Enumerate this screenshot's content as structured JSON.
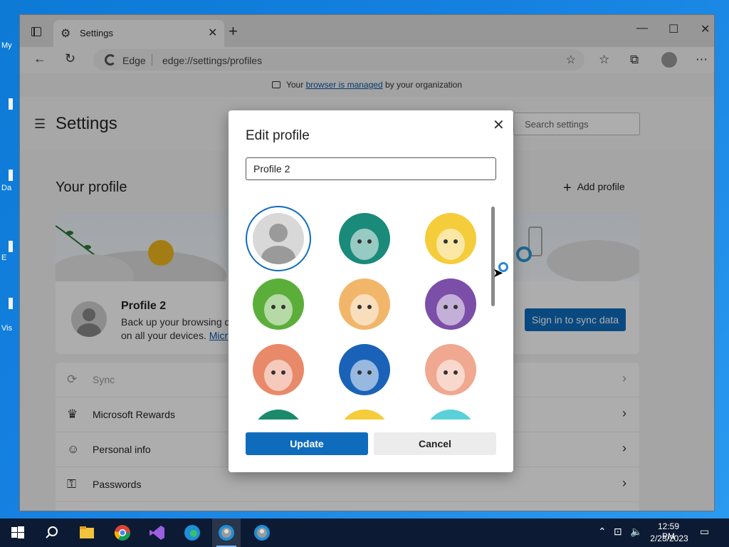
{
  "desktop": {
    "labels": [
      "My",
      "Da",
      "E",
      "Vis"
    ]
  },
  "browser": {
    "tab_title": "Settings",
    "new_tab_symbol": "+",
    "address_brand": "Edge",
    "address_url": "edge://settings/profiles",
    "managed_prefix": "Your ",
    "managed_link": "browser is managed",
    "managed_suffix": " by your organization"
  },
  "settings": {
    "title": "Settings",
    "search_placeholder": "Search settings",
    "your_profile": "Your profile",
    "add_profile": "Add profile",
    "profile_name": "Profile 2",
    "profile_desc_line1": "Back up your browsing d",
    "profile_desc_line2": "on all your devices. ",
    "profile_desc_link": "Micr",
    "sign_in_button": "Sign in to sync data",
    "rows": [
      {
        "label": "Sync",
        "icon": "sync-icon",
        "dim": true
      },
      {
        "label": "Microsoft Rewards",
        "icon": "trophy-icon",
        "dim": false
      },
      {
        "label": "Personal info",
        "icon": "person-info-icon",
        "dim": false
      },
      {
        "label": "Passwords",
        "icon": "key-icon",
        "dim": false
      }
    ]
  },
  "dialog": {
    "title": "Edit profile",
    "name_value": "Profile 2",
    "update_label": "Update",
    "cancel_label": "Cancel",
    "avatars": [
      {
        "name": "default-person-avatar",
        "selected": true,
        "bg": "#d8d8d8"
      },
      {
        "name": "llama-avatar",
        "selected": false,
        "bg": "#1a8a7a"
      },
      {
        "name": "fox-avatar",
        "selected": false,
        "bg": "#f5cc3a"
      },
      {
        "name": "panda-avatar",
        "selected": false,
        "bg": "#5cae3a"
      },
      {
        "name": "hedgehog-avatar",
        "selected": false,
        "bg": "#f2b66a"
      },
      {
        "name": "astronaut-avatar",
        "selected": false,
        "bg": "#7b4ea8"
      },
      {
        "name": "ninja-avatar",
        "selected": false,
        "bg": "#e8896a"
      },
      {
        "name": "yeti-avatar",
        "selected": false,
        "bg": "#1a62b8"
      },
      {
        "name": "dinosaur-avatar",
        "selected": false,
        "bg": "#f0a890"
      },
      {
        "name": "avatar-row4-1",
        "selected": false,
        "bg": "#1a8a6a"
      },
      {
        "name": "avatar-row4-2",
        "selected": false,
        "bg": "#f5cc3a"
      },
      {
        "name": "avatar-row4-3",
        "selected": false,
        "bg": "#5ad0d8"
      }
    ]
  },
  "taskbar": {
    "time": "12:59 PM",
    "date": "2/23/2023"
  },
  "colors": {
    "accent": "#0f6cbd",
    "taskbar": "#0c1a33"
  }
}
